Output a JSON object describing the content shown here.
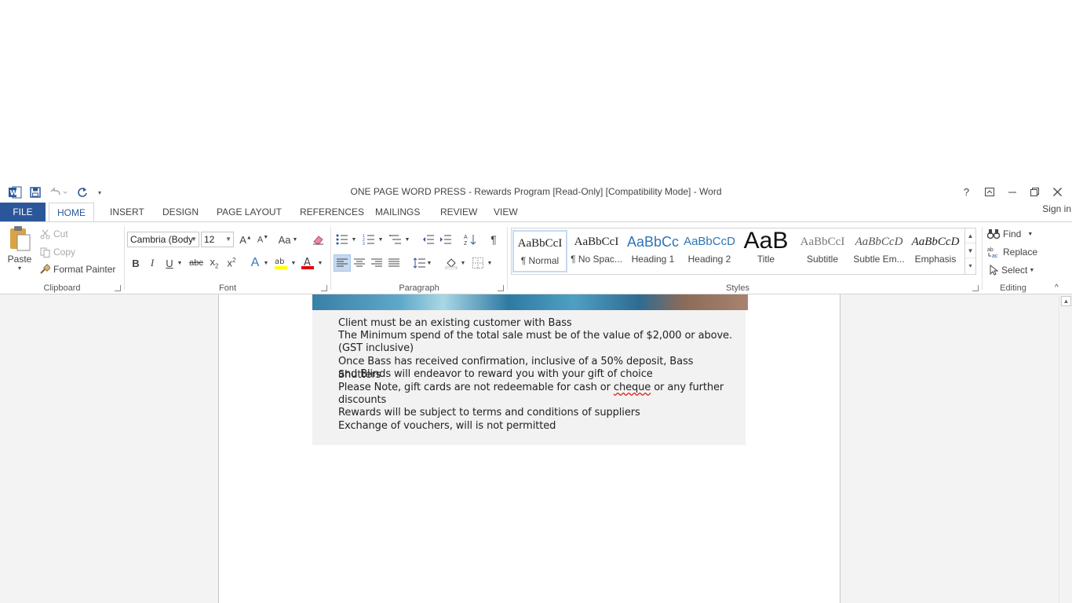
{
  "window": {
    "title": "ONE PAGE WORD PRESS - Rewards Program  [Read-Only] [Compatibility Mode] - Word"
  },
  "tabs": [
    "FILE",
    "HOME",
    "INSERT",
    "DESIGN",
    "PAGE LAYOUT",
    "REFERENCES",
    "MAILINGS",
    "REVIEW",
    "VIEW"
  ],
  "signin": "Sign in",
  "clipboard": {
    "paste": "Paste",
    "cut": "Cut",
    "copy": "Copy",
    "format_painter": "Format Painter",
    "label": "Clipboard"
  },
  "font": {
    "name": "Cambria (Body",
    "size": "12",
    "change_case": "Aa",
    "label": "Font"
  },
  "paragraph": {
    "label": "Paragraph"
  },
  "styles": {
    "label": "Styles",
    "items": [
      {
        "sample": "AaBbCcI",
        "name": "¶ Normal"
      },
      {
        "sample": "AaBbCcI",
        "name": "¶ No Spac..."
      },
      {
        "sample": "AaBbCc",
        "name": "Heading 1"
      },
      {
        "sample": "AaBbCcD",
        "name": "Heading 2"
      },
      {
        "sample": "AaB",
        "name": "Title"
      },
      {
        "sample": "AaBbCcI",
        "name": "Subtitle"
      },
      {
        "sample": "AaBbCcD",
        "name": "Subtle Em..."
      },
      {
        "sample": "AaBbCcD",
        "name": "Emphasis"
      }
    ]
  },
  "editing": {
    "find": "Find",
    "replace": "Replace",
    "select": "Select",
    "label": "Editing"
  },
  "document": {
    "lines": [
      "Client must be an existing customer with Bass",
      "The Minimum spend of the total sale must be of the value of $2,000 or above.",
      "(GST inclusive)",
      "Once Bass has received confirmation, inclusive of a 50% deposit, Bass Shutters",
      "and Blinds will endeavor to reward you with your gift of choice",
      "Please Note, gift cards are not redeemable for cash or ",
      "cheque",
      " or any further",
      "discounts",
      "Rewards will be subject to terms and conditions of suppliers",
      "Exchange of vouchers, will is not permitted"
    ]
  },
  "colors": {
    "file_tab": "#2b579a",
    "accent": "#2b579a",
    "highlight": "#ffff00",
    "font_color": "#e00000"
  }
}
